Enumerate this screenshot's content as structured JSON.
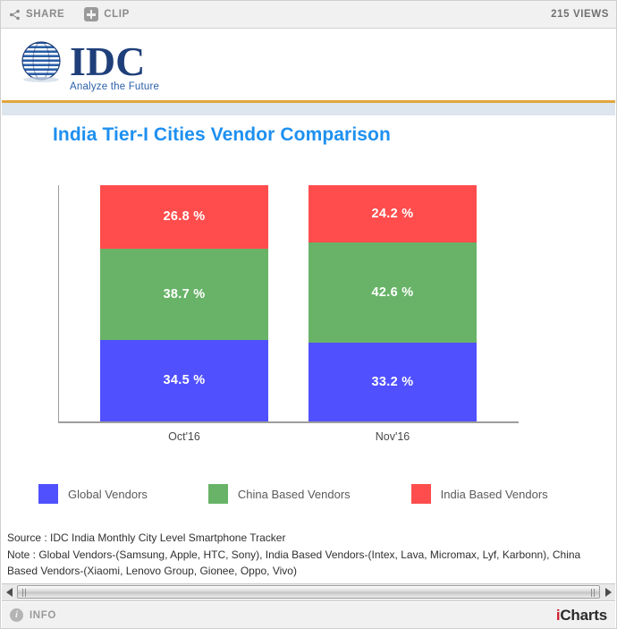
{
  "toolbar": {
    "share_label": "SHARE",
    "share_icon": "share-nodes-icon",
    "clip_label": "CLIP",
    "clip_icon": "plus-square-icon",
    "views": "215 VIEWS"
  },
  "brand_header": {
    "name": "IDC",
    "tagline": "Analyze the Future",
    "logo_icon": "idc-globe-icon",
    "rule_color": "#e2a63c",
    "band_color": "#dde6ef"
  },
  "chart_data": {
    "type": "bar",
    "stacked": true,
    "title": "India Tier-I Cities Vendor Comparison",
    "xlabel": "",
    "ylabel": "",
    "ylim": [
      0,
      100
    ],
    "grid": false,
    "legend_position": "bottom",
    "categories": [
      "Oct'16",
      "Nov'16"
    ],
    "series": [
      {
        "name": "Global Vendors",
        "color": "#5050ff",
        "values": [
          34.5,
          33.2
        ],
        "labels": [
          "34.5 %",
          "33.2 %"
        ]
      },
      {
        "name": "China Based Vendors",
        "color": "#68b368",
        "values": [
          38.7,
          42.6
        ],
        "labels": [
          "38.7 %",
          "42.6 %"
        ]
      },
      {
        "name": "India Based Vendors",
        "color": "#ff4d4d",
        "values": [
          26.8,
          24.2
        ],
        "labels": [
          "26.8 %",
          "24.2 %"
        ]
      }
    ]
  },
  "notes": {
    "source": "Source : IDC India Monthly City Level Smartphone Tracker",
    "note": "Note : Global Vendors-(Samsung, Apple, HTC, Sony), India Based Vendors-(Intex, Lava, Micromax, Lyf, Karbonn), China Based Vendors-(Xiaomi, Lenovo Group, Gionee, Oppo, Vivo)"
  },
  "scrollbar": {
    "left_arrow_icon": "triangle-left-icon",
    "right_arrow_icon": "triangle-right-icon"
  },
  "footer": {
    "info_label": "INFO",
    "info_icon": "info-circle-icon",
    "brand_prefix": "i",
    "brand_suffix": "Charts"
  }
}
